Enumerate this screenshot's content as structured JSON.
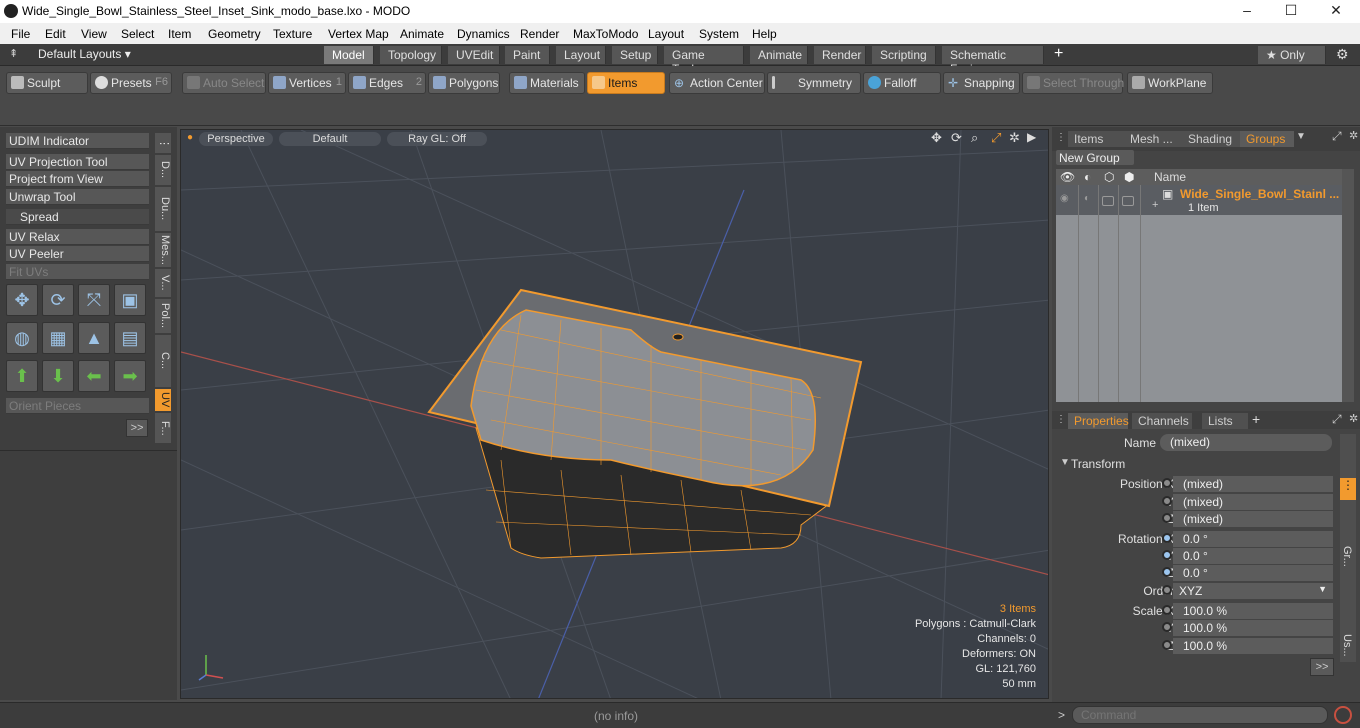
{
  "window": {
    "title": "Wide_Single_Bowl_Stainless_Steel_Inset_Sink_modo_base.lxo - MODO",
    "controls": [
      "–",
      "☐",
      "✕"
    ]
  },
  "menu": [
    "File",
    "Edit",
    "View",
    "Select",
    "Item",
    "Geometry",
    "Texture",
    "Vertex Map",
    "Animate",
    "Dynamics",
    "Render",
    "MaxToModo",
    "Layout",
    "System",
    "Help"
  ],
  "layouts": {
    "dropdown": "Default Layouts ▾",
    "tabs": [
      "Model",
      "Topology",
      "UVEdit",
      "Paint",
      "Layout",
      "Setup",
      "Game Tools",
      "Animate",
      "Render",
      "Scripting",
      "Schematic Fusion"
    ],
    "active": "Model",
    "add": "+",
    "only": "★  Only",
    "gear": "⚙"
  },
  "toolbar": {
    "sculpt": "Sculpt",
    "presets": "Presets",
    "presets_key": "F6",
    "auto_select": "Auto Select",
    "vertices": "Vertices",
    "vertices_num": "1",
    "edges": "Edges",
    "edges_num": "2",
    "polygons": "Polygons",
    "materials": "Materials",
    "items": "Items",
    "action_center": "Action Center",
    "symmetry": "Symmetry",
    "falloff": "Falloff",
    "snapping": "Snapping",
    "select_through": "Select Through",
    "workplane": "WorkPlane"
  },
  "left": {
    "buttons": [
      "UDIM Indicator",
      "UV Projection Tool",
      "Project from View",
      "Unwrap Tool",
      "Spread",
      "UV Relax",
      "UV Peeler",
      "Fit UVs"
    ],
    "orient": "Orient Pieces",
    "more": ">>",
    "vtabs": [
      "D...",
      "Du...",
      "Mes...",
      "V...",
      "Pol...",
      "C...",
      "UV",
      "F..."
    ]
  },
  "viewport": {
    "view": "Perspective",
    "style": "Default",
    "raygl": "Ray GL: Off",
    "info": {
      "items": "3 Items",
      "polygons": "Polygons : Catmull-Clark",
      "channels": "Channels: 0",
      "deformers": "Deformers: ON",
      "gl": "GL: 121,760",
      "scale": "50 mm"
    }
  },
  "right_top": {
    "tabs": [
      "Items",
      "Mesh ...",
      "Shading",
      "Groups"
    ],
    "active": "Groups",
    "new_group": "New Group",
    "col_name": "Name",
    "group_name": "Wide_Single_Bowl_Stainl ...",
    "group_sub": "1 Item"
  },
  "properties": {
    "tabs": [
      "Properties",
      "Channels",
      "Lists"
    ],
    "active": "Properties",
    "name_label": "Name",
    "name_value": "(mixed)",
    "transform": "Transform",
    "position_x_label": "Position X",
    "y_label": "Y",
    "z_label": "Z",
    "position": [
      "(mixed)",
      "(mixed)",
      "(mixed)"
    ],
    "rotation_x_label": "Rotation X",
    "rotation": [
      "0.0 °",
      "0.0 °",
      "0.0 °"
    ],
    "order_label": "Order",
    "order_value": "XYZ",
    "scale_x_label": "Scale X",
    "scale": [
      "100.0 %",
      "100.0 %",
      "100.0 %"
    ],
    "side_tabs": [
      "Gr...",
      "Us..."
    ],
    "more": ">>"
  },
  "status": {
    "info": "(no info)",
    "command_placeholder": "Command"
  }
}
